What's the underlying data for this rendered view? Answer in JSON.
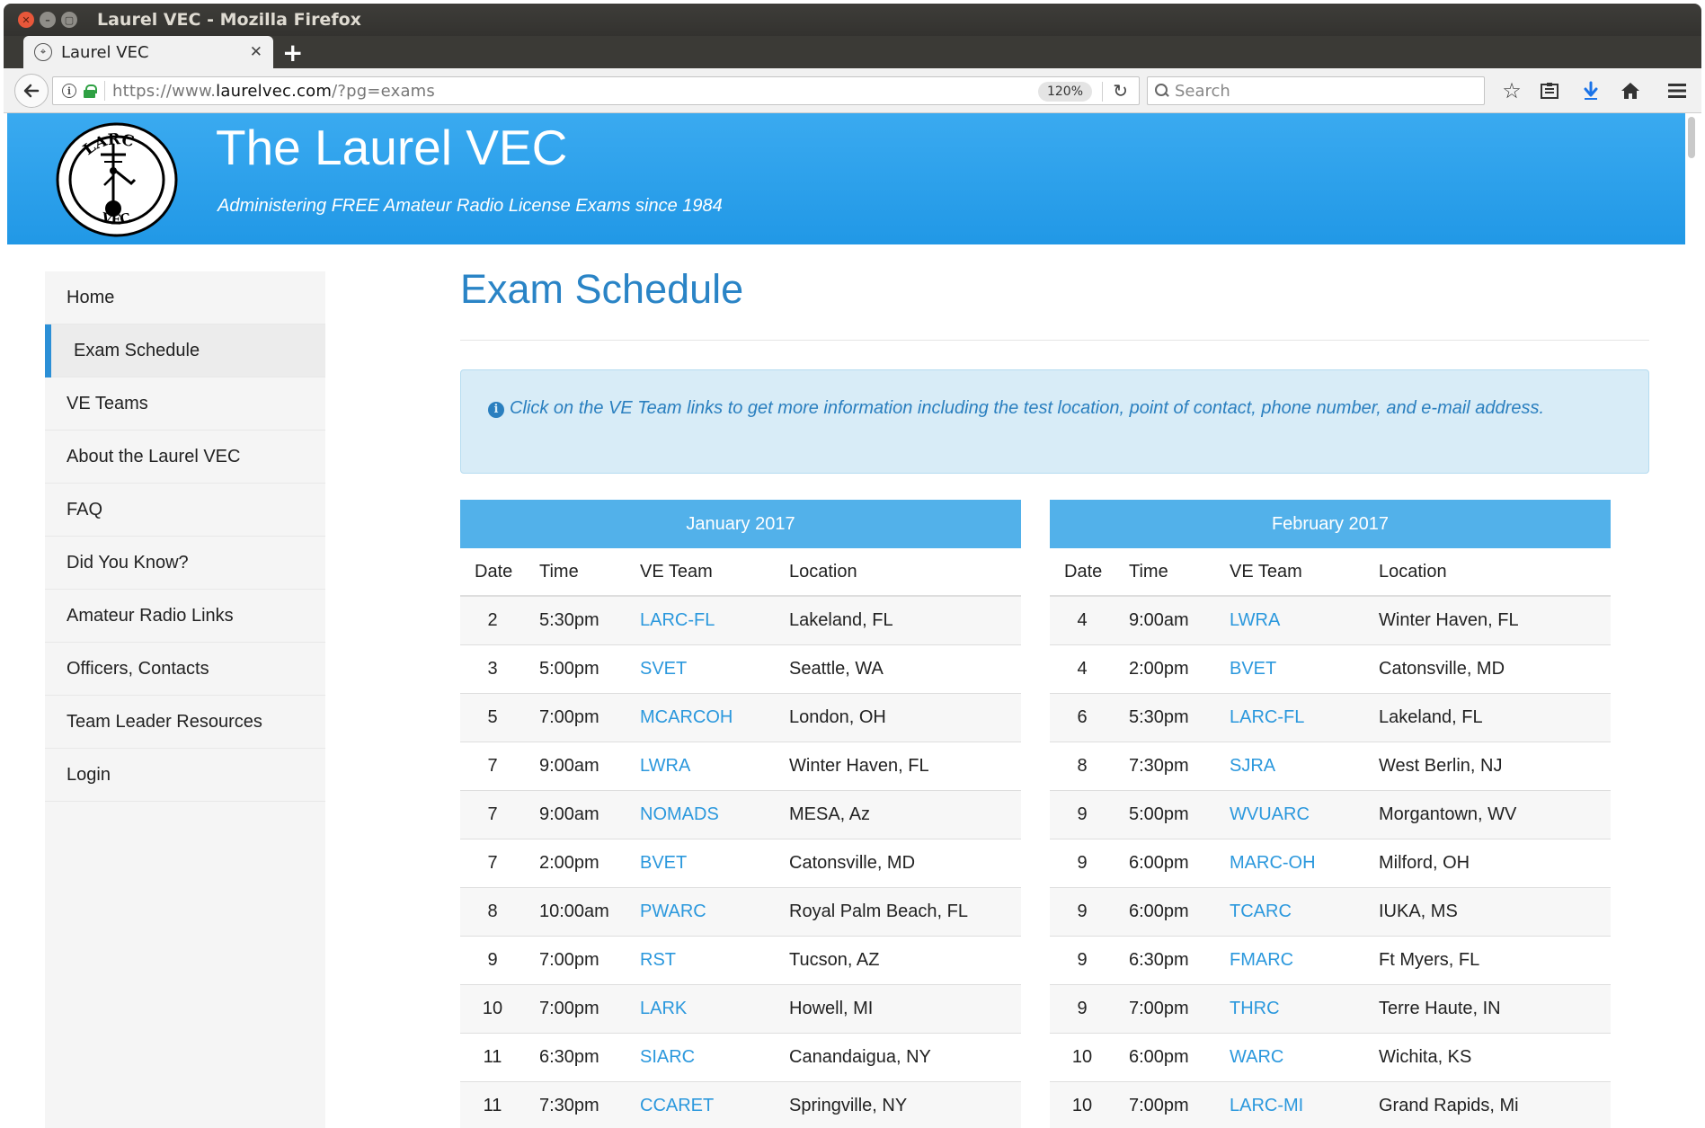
{
  "browser": {
    "window_title": "Laurel VEC - Mozilla Firefox",
    "tab_title": "Laurel VEC",
    "url_scheme": "https://www.",
    "url_host": "laurelvec.com",
    "url_path": "/?pg=exams",
    "zoom": "120%",
    "search_placeholder": "Search"
  },
  "site": {
    "title": "The Laurel VEC",
    "tagline": "Administering FREE Amateur Radio License Exams since 1984"
  },
  "sidebar": {
    "items": [
      {
        "label": "Home"
      },
      {
        "label": "Exam Schedule"
      },
      {
        "label": "VE Teams"
      },
      {
        "label": "About the Laurel VEC"
      },
      {
        "label": "FAQ"
      },
      {
        "label": "Did You Know?"
      },
      {
        "label": "Amateur Radio Links"
      },
      {
        "label": "Officers, Contacts"
      },
      {
        "label": "Team Leader Resources"
      },
      {
        "label": "Login"
      }
    ]
  },
  "main": {
    "heading": "Exam Schedule",
    "alert": "Click on the VE Team links to get more information including the test location, point of contact, phone number, and e-mail address."
  },
  "columns": {
    "date": "Date",
    "time": "Time",
    "team": "VE Team",
    "location": "Location"
  },
  "schedules": [
    {
      "month": "January 2017",
      "rows": [
        {
          "date": "2",
          "time": "5:30pm",
          "team": "LARC-FL",
          "location": "Lakeland, FL"
        },
        {
          "date": "3",
          "time": "5:00pm",
          "team": "SVET",
          "location": "Seattle, WA"
        },
        {
          "date": "5",
          "time": "7:00pm",
          "team": "MCARCOH",
          "location": "London, OH"
        },
        {
          "date": "7",
          "time": "9:00am",
          "team": "LWRA",
          "location": "Winter Haven, FL"
        },
        {
          "date": "7",
          "time": "9:00am",
          "team": "NOMADS",
          "location": "MESA, Az"
        },
        {
          "date": "7",
          "time": "2:00pm",
          "team": "BVET",
          "location": "Catonsville, MD"
        },
        {
          "date": "8",
          "time": "10:00am",
          "team": "PWARC",
          "location": "Royal Palm Beach, FL"
        },
        {
          "date": "9",
          "time": "7:00pm",
          "team": "RST",
          "location": "Tucson, AZ"
        },
        {
          "date": "10",
          "time": "7:00pm",
          "team": "LARK",
          "location": "Howell, MI"
        },
        {
          "date": "11",
          "time": "6:30pm",
          "team": "SIARC",
          "location": "Canandaigua, NY"
        },
        {
          "date": "11",
          "time": "7:30pm",
          "team": "CCARET",
          "location": "Springville, NY"
        }
      ]
    },
    {
      "month": "February 2017",
      "rows": [
        {
          "date": "4",
          "time": "9:00am",
          "team": "LWRA",
          "location": "Winter Haven, FL"
        },
        {
          "date": "4",
          "time": "2:00pm",
          "team": "BVET",
          "location": "Catonsville, MD"
        },
        {
          "date": "6",
          "time": "5:30pm",
          "team": "LARC-FL",
          "location": "Lakeland, FL"
        },
        {
          "date": "8",
          "time": "7:30pm",
          "team": "SJRA",
          "location": "West Berlin, NJ"
        },
        {
          "date": "9",
          "time": "5:00pm",
          "team": "WVUARC",
          "location": "Morgantown, WV"
        },
        {
          "date": "9",
          "time": "6:00pm",
          "team": "MARC-OH",
          "location": "Milford, OH"
        },
        {
          "date": "9",
          "time": "6:00pm",
          "team": "TCARC",
          "location": "IUKA, MS"
        },
        {
          "date": "9",
          "time": "6:30pm",
          "team": "FMARC",
          "location": "Ft Myers, FL"
        },
        {
          "date": "9",
          "time": "7:00pm",
          "team": "THRC",
          "location": "Terre Haute, IN"
        },
        {
          "date": "10",
          "time": "6:00pm",
          "team": "WARC",
          "location": "Wichita, KS"
        },
        {
          "date": "10",
          "time": "7:00pm",
          "team": "LARC-MI",
          "location": "Grand Rapids, Mi"
        }
      ]
    }
  ],
  "logo": {
    "top_text": "LARC",
    "bottom_text": "VEC"
  },
  "colors": {
    "header": "#2198e6",
    "link": "#2b98dd",
    "heading": "#2a84c6",
    "table_head": "#52b1ea",
    "alert_bg": "#d8ecf7"
  }
}
